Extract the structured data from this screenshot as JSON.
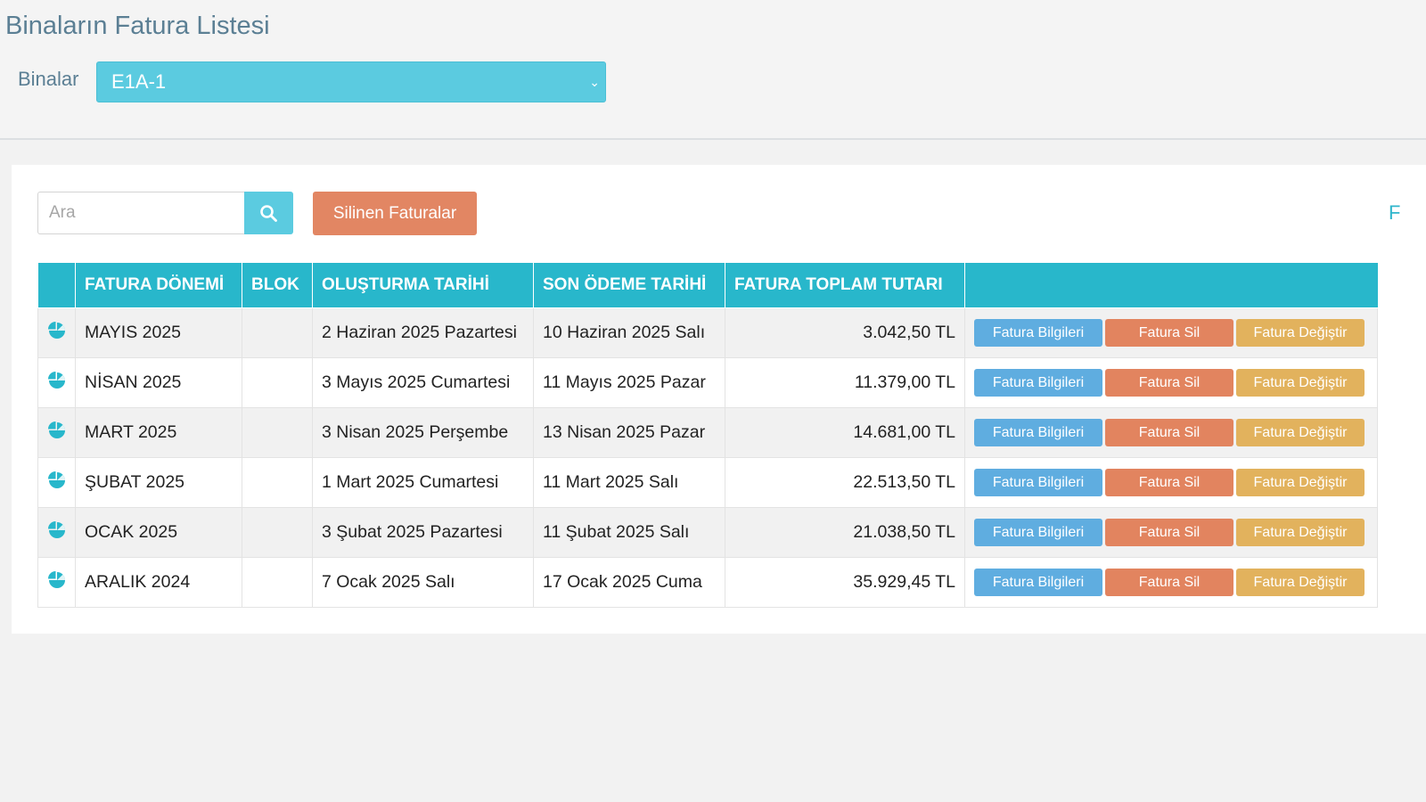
{
  "page": {
    "title": "Binaların Fatura Listesi"
  },
  "building_filter": {
    "label": "Binalar",
    "selected": "E1A-1"
  },
  "toolbar": {
    "search_placeholder": "Ara",
    "deleted_invoices_label": "Silinen Faturalar",
    "edge_link_fragment": "F"
  },
  "table": {
    "columns": [
      "",
      "FATURA DÖNEMİ",
      "BLOK",
      "OLUŞTURMA TARİHİ",
      "SON ÖDEME TARİHİ",
      "FATURA TOPLAM TUTARI",
      ""
    ],
    "row_icon": "pie-chart-icon",
    "actions": {
      "info": "Fatura Bilgileri",
      "delete": "Fatura Sil",
      "edit": "Fatura Değiştir"
    },
    "rows": [
      {
        "period": "MAYIS 2025",
        "block": "",
        "created": "2 Haziran 2025 Pazartesi",
        "due": "10 Haziran 2025 Salı",
        "total": "3.042,50 TL"
      },
      {
        "period": "NİSAN 2025",
        "block": "",
        "created": "3 Mayıs 2025 Cumartesi",
        "due": "11 Mayıs 2025 Pazar",
        "total": "11.379,00 TL"
      },
      {
        "period": "MART 2025",
        "block": "",
        "created": "3 Nisan 2025 Perşembe",
        "due": "13 Nisan 2025 Pazar",
        "total": "14.681,00 TL"
      },
      {
        "period": "ŞUBAT 2025",
        "block": "",
        "created": "1 Mart 2025 Cumartesi",
        "due": "11 Mart 2025 Salı",
        "total": "22.513,50 TL"
      },
      {
        "period": "OCAK 2025",
        "block": "",
        "created": "3 Şubat 2025 Pazartesi",
        "due": "11 Şubat 2025 Salı",
        "total": "21.038,50 TL"
      },
      {
        "period": "ARALIK 2024",
        "block": "",
        "created": "7 Ocak 2025 Salı",
        "due": "17 Ocak 2025 Cuma",
        "total": "35.929,45 TL"
      }
    ]
  },
  "colors": {
    "title": "#5b7f94",
    "accent": "#28b7cb",
    "select_bg": "#5bcbe0",
    "info_button": "#5fade0",
    "delete_button": "#e2845f",
    "edit_button": "#e2b25d",
    "deleted_invoices_button": "#e28663"
  }
}
